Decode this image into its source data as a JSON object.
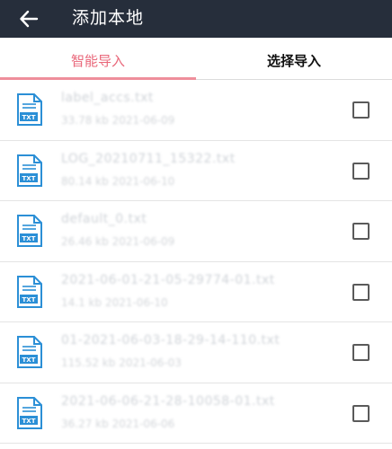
{
  "appbar": {
    "title": "添加本地",
    "back_icon": "arrow-left-icon"
  },
  "tabs": [
    {
      "label": "智能导入",
      "active": true
    },
    {
      "label": "选择导入",
      "active": false
    }
  ],
  "colors": {
    "appbar": "#262e3b",
    "accent": "#e9677a",
    "file_icon": "#2b8fd6"
  },
  "files": [
    {
      "name": "label_accs.txt",
      "size": "33.78 kb",
      "date": "2021-06-09",
      "checked": false
    },
    {
      "name": "LOG_20210711_15322.txt",
      "size": "80.14 kb",
      "date": "2021-06-10",
      "checked": false
    },
    {
      "name": "default_0.txt",
      "size": "26.46 kb",
      "date": "2021-06-09",
      "checked": false
    },
    {
      "name": "2021-06-01-21-05-29774-01.txt",
      "size": "14.1 kb",
      "date": "2021-06-10",
      "checked": false
    },
    {
      "name": "01-2021-06-03-18-29-14-110.txt",
      "size": "115.52 kb",
      "date": "2021-06-03",
      "checked": false
    },
    {
      "name": "2021-06-06-21-28-10058-01.txt",
      "size": "36.27 kb",
      "date": "2021-06-06",
      "checked": false
    }
  ],
  "file_icon_label": "TXT"
}
